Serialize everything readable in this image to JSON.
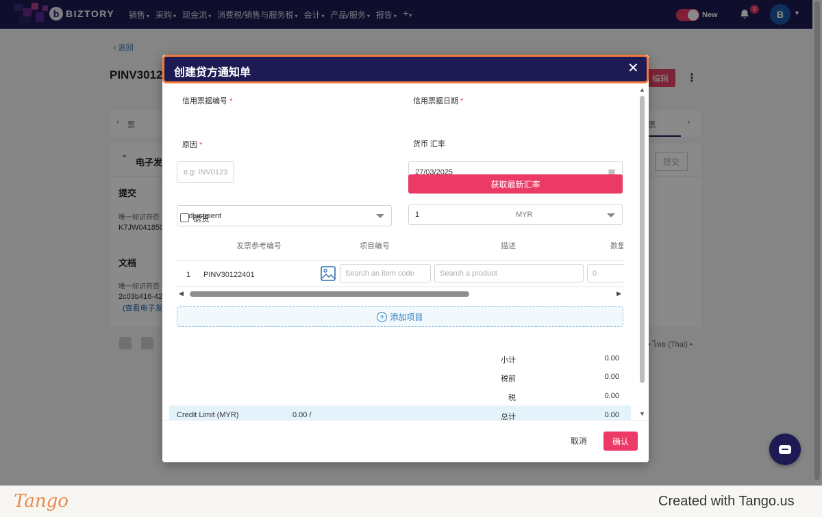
{
  "nav": {
    "brand": "BIZTORY",
    "menu": [
      {
        "label": "销售"
      },
      {
        "label": "采购"
      },
      {
        "label": "现金流"
      },
      {
        "label": "消费税/销售与服务税"
      },
      {
        "label": "会计"
      },
      {
        "label": "产品/服务"
      },
      {
        "label": "报告"
      }
    ],
    "plus": "+",
    "toggle_label": "New",
    "notification_count": "9",
    "avatar_initial": "B",
    "accent_color": "#1e1a54"
  },
  "background": {
    "back_link": "返回",
    "doc_title": "PINV3012",
    "edit_button": "编辑",
    "tab_left": "票",
    "tab_right": "票",
    "section_title": "电子发",
    "submit_button": "提交",
    "submission_heading": "提交",
    "unique_id_label_1": "唯一标识符否",
    "unique_id_value_1": "K7JW041850",
    "document_heading": "文档",
    "unique_id_label_2": "唯一标识符否",
    "unique_id_value_2": "2c03b416-42",
    "view_einvoice_link": "(查看电子发",
    "language_text": "• ไทย (Thai) •"
  },
  "modal": {
    "title": "创建贷方通知单",
    "fields": {
      "credit_note_no_label": "信用票据编号",
      "credit_note_no_placeholder": "e.g: INV0123",
      "credit_note_date_label": "信用票据日期",
      "credit_note_date_value": "27/03/2025",
      "reason_label": "原因",
      "reason_value": "Adjustment",
      "currency_label": "货币 汇率",
      "rate_value": "1",
      "currency_value": "MYR",
      "get_rate_button": "获取最新汇率",
      "return_label": "退货"
    },
    "table": {
      "headers": [
        "发票参考编号",
        "项目编号",
        "描述",
        "数量"
      ],
      "rows": [
        {
          "index": "1",
          "invoice_ref": "PINV30122401",
          "item_code_placeholder": "Search an item code",
          "product_placeholder": "Search a product",
          "quantity_placeholder": "0"
        }
      ],
      "add_item": "添加项目"
    },
    "summary": {
      "subtotal_label": "小计",
      "subtotal_value": "0.00",
      "pretax_label": "税前",
      "pretax_value": "0.00",
      "tax_label": "税",
      "tax_value": "0.00",
      "total_label": "总计",
      "total_value": "0.00",
      "credit_limit_label": "Credit Limit (MYR)",
      "credit_limit_value": "0.00 /"
    },
    "cancel_button": "取消",
    "confirm_button": "确认"
  },
  "footer": {
    "tango_logo": "Tango",
    "created_with": "Created with Tango.us"
  }
}
